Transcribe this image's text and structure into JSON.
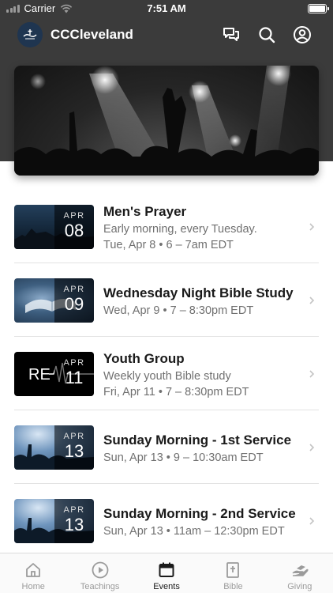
{
  "status_bar": {
    "carrier": "Carrier",
    "time": "7:51 AM"
  },
  "header": {
    "title": "CCCleveland",
    "logo_icon": "church-logo-icon"
  },
  "hero": {
    "image": "concert-crowd-hands-raised"
  },
  "events": [
    {
      "month": "APR",
      "day": "08",
      "title": "Men's Prayer",
      "description": "Early morning, every Tuesday.",
      "when": "Tue, Apr 8 • 6 – 7am EDT",
      "thumb": "dark-blue-landscape"
    },
    {
      "month": "APR",
      "day": "09",
      "title": "Wednesday Night Bible Study",
      "description": "",
      "when": "Wed, Apr 9 • 7 – 8:30pm EDT",
      "thumb": "open-bible"
    },
    {
      "month": "APR",
      "day": "11",
      "title": "Youth Group",
      "description": "Weekly youth Bible study",
      "when": "Fri, Apr 11 • 7 – 8:30pm EDT",
      "thumb": "RE-waveform-logo"
    },
    {
      "month": "APR",
      "day": "13",
      "title": "Sunday Morning - 1st Service",
      "description": "",
      "when": "Sun, Apr 13 • 9 – 10:30am EDT",
      "thumb": "worship-crowd-blue"
    },
    {
      "month": "APR",
      "day": "13",
      "title": "Sunday Morning - 2nd Service",
      "description": "",
      "when": "Sun, Apr 13 • 11am – 12:30pm EDT",
      "thumb": "worship-crowd-blue"
    }
  ],
  "thumb_text": {
    "re": "RE"
  },
  "tabs": [
    {
      "label": "Home",
      "icon": "home-icon",
      "active": false
    },
    {
      "label": "Teachings",
      "icon": "play-circle-icon",
      "active": false
    },
    {
      "label": "Events",
      "icon": "calendar-icon",
      "active": true
    },
    {
      "label": "Bible",
      "icon": "bible-icon",
      "active": false
    },
    {
      "label": "Giving",
      "icon": "giving-hand-icon",
      "active": false
    }
  ]
}
